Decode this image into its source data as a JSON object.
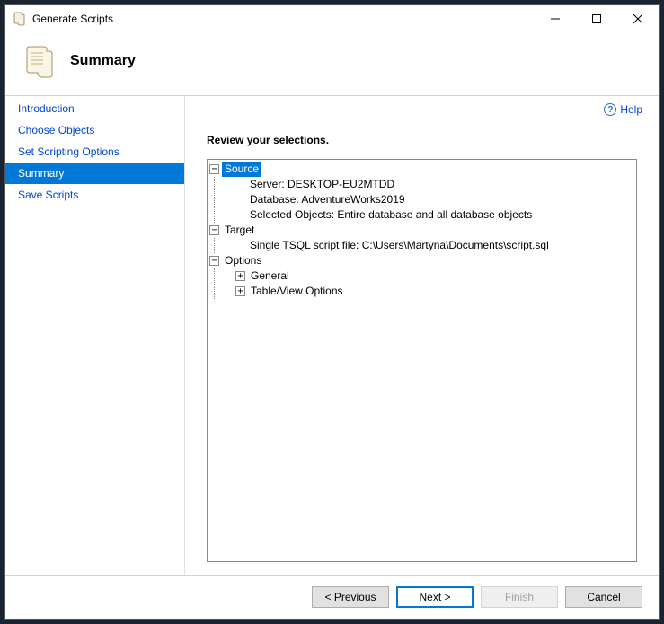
{
  "window": {
    "title": "Generate Scripts"
  },
  "header": {
    "title": "Summary"
  },
  "help": {
    "label": "Help"
  },
  "sidebar": {
    "items": [
      {
        "label": "Introduction"
      },
      {
        "label": "Choose Objects"
      },
      {
        "label": "Set Scripting Options"
      },
      {
        "label": "Summary"
      },
      {
        "label": "Save Scripts"
      }
    ],
    "activeIndex": 3
  },
  "main": {
    "instruction": "Review your selections.",
    "tree": {
      "source": {
        "label": "Source",
        "server": "Server: DESKTOP-EU2MTDD",
        "database": "Database: AdventureWorks2019",
        "selected": "Selected Objects: Entire database and all database objects"
      },
      "target": {
        "label": "Target",
        "file": "Single TSQL script file: C:\\Users\\Martyna\\Documents\\script.sql"
      },
      "options": {
        "label": "Options",
        "general": "General",
        "tableview": "Table/View Options"
      }
    }
  },
  "buttons": {
    "previous": "< Previous",
    "next": "Next >",
    "finish": "Finish",
    "cancel": "Cancel"
  }
}
